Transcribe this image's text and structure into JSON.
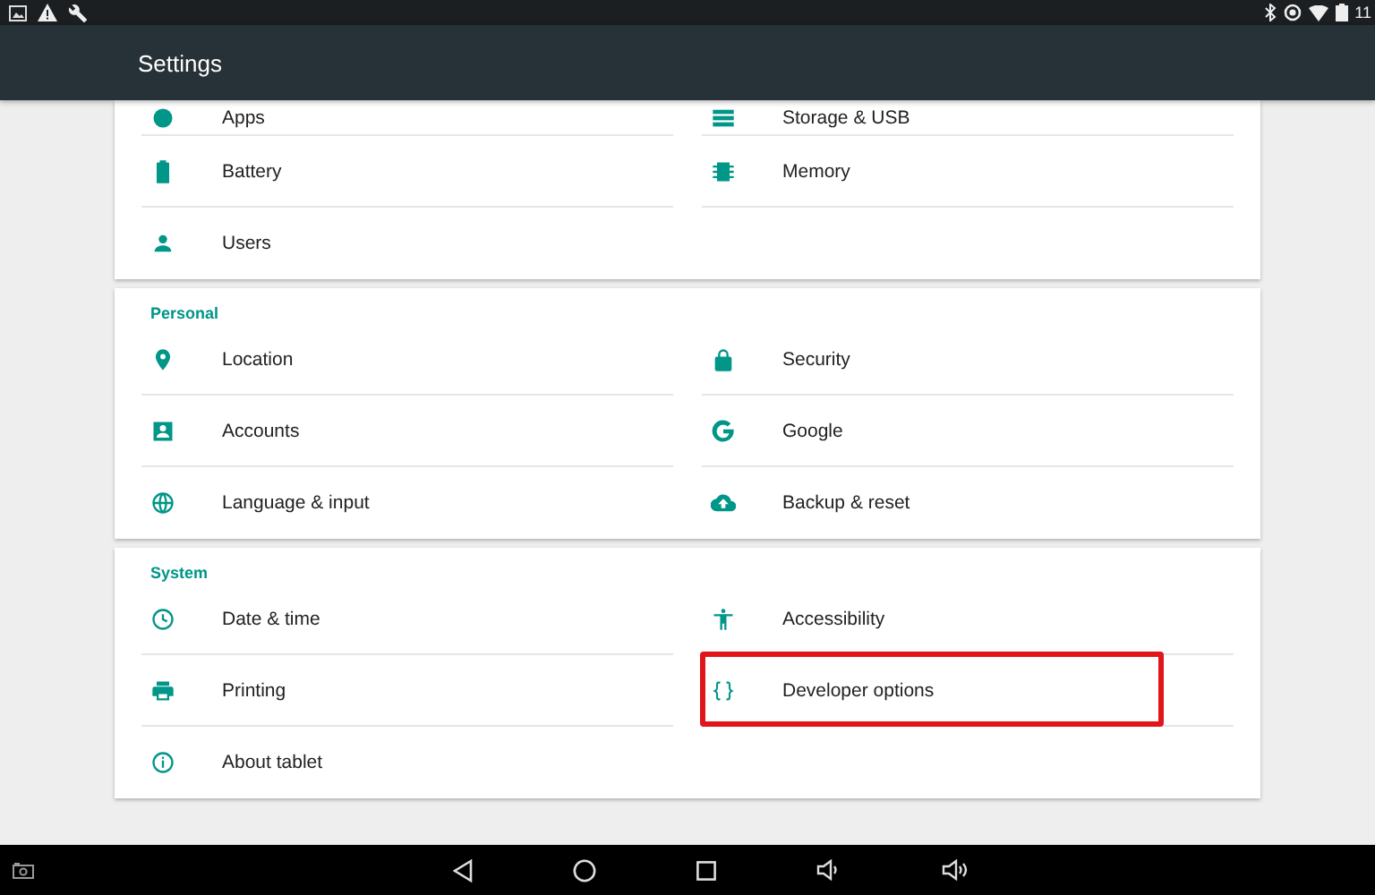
{
  "status_bar": {
    "time": "11"
  },
  "app_bar": {
    "title": "Settings"
  },
  "cards": [
    {
      "items": [
        {
          "label": "Apps",
          "highlighted": false
        },
        {
          "label": "Storage & USB",
          "highlighted": false
        },
        {
          "label": "Battery",
          "highlighted": false
        },
        {
          "label": "Memory",
          "highlighted": false
        },
        {
          "label": "Users",
          "highlighted": false
        }
      ]
    },
    {
      "title": "Personal",
      "items": [
        {
          "label": "Location",
          "highlighted": false
        },
        {
          "label": "Security",
          "highlighted": false
        },
        {
          "label": "Accounts",
          "highlighted": false
        },
        {
          "label": "Google",
          "highlighted": false
        },
        {
          "label": "Language & input",
          "highlighted": false
        },
        {
          "label": "Backup & reset",
          "highlighted": false
        }
      ]
    },
    {
      "title": "System",
      "items": [
        {
          "label": "Date & time",
          "highlighted": false
        },
        {
          "label": "Accessibility",
          "highlighted": false
        },
        {
          "label": "Printing",
          "highlighted": false
        },
        {
          "label": "Developer options",
          "highlighted": true
        },
        {
          "label": "About tablet",
          "highlighted": false
        }
      ]
    }
  ]
}
